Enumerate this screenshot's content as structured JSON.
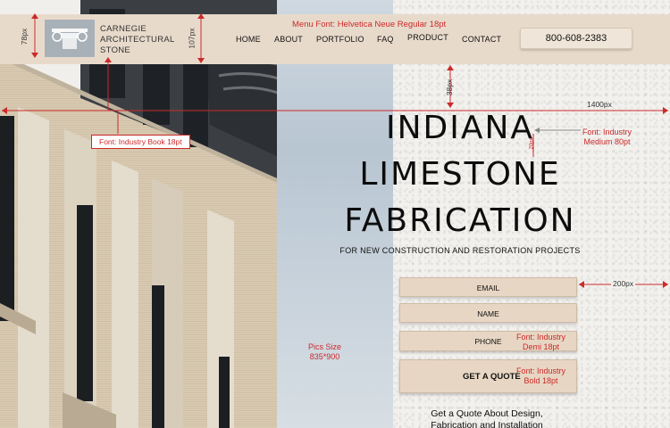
{
  "header": {
    "brand_lines": [
      "CARNEGIE",
      "ARCHITECTURAL",
      "STONE"
    ],
    "nav": [
      {
        "label": "HOME"
      },
      {
        "label": "ABOUT"
      },
      {
        "label": "PORTFOLIO"
      },
      {
        "label": "FAQ"
      },
      {
        "label": "PRODUCT"
      },
      {
        "label": "CONTACT"
      }
    ],
    "phone": "800-608-2383"
  },
  "hero": {
    "title_lines": [
      "INDIANA",
      "LIMESTONE",
      "FABRICATION"
    ],
    "subtitle": "FOR NEW CONSTRUCTION AND RESTORATION PROJECTS"
  },
  "form": {
    "email": "EMAIL",
    "name": "NAME",
    "phone": "PHONE",
    "submit": "GET A QUOTE",
    "tagline_lines": [
      "Get a Quote About  Design,",
      "Fabrication and Installation"
    ]
  },
  "annotations": {
    "menu_font": "Menu Font: Helvetica Neue Regular 18pt",
    "book_font": "Font: Industry Book 18pt",
    "medium_font": [
      "Font: Industry",
      "Medium 80pt"
    ],
    "demi_font": [
      "Font: Industry",
      "Demi 18pt"
    ],
    "bold_font": [
      "Font: Industry",
      "Bold 18pt"
    ],
    "pics_size": [
      "Pics Size",
      "835*900"
    ],
    "dim_78": "78px",
    "dim_107": "107px",
    "dim_38": "38px",
    "dim_1400": "1400px",
    "dim_200": "200px",
    "dim_small": "20px"
  },
  "colors": {
    "header_bg": "#e8dacb",
    "button_bg": "#e7d6c3",
    "annotation_red": "#cc2a2a"
  }
}
